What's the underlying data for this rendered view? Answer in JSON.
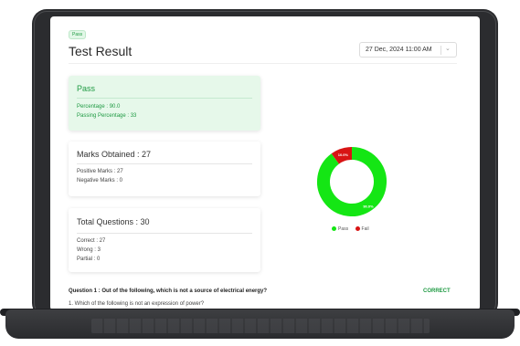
{
  "status_chip": "Pass",
  "title": "Test Result",
  "date_select": {
    "value": "27 Dec, 2024 11:00 AM"
  },
  "pass_card": {
    "heading": "Pass",
    "percentage": "Percentage : 90.0",
    "passing_percentage": "Passing Percentage : 33"
  },
  "marks_card": {
    "heading": "Marks Obtained : 27",
    "positive": "Positive Marks : 27",
    "negative": "Negative Marks : 0"
  },
  "total_card": {
    "heading": "Total Questions : 30",
    "correct": "Correct : 27",
    "wrong": "Wrong : 3",
    "partial": "Partial : 0"
  },
  "chart_data": {
    "type": "pie",
    "title": "",
    "categories": [
      "Pass",
      "Fail"
    ],
    "values": [
      90.0,
      10.0
    ],
    "labels": [
      "90.0%",
      "10.0%"
    ],
    "colors": [
      "#14e614",
      "#d81414"
    ],
    "donut": true,
    "legend": "bottom"
  },
  "question": {
    "title": "Question 1 : Out of the following, which is not a source of electrical energy?",
    "status": "CORRECT",
    "next_line": "1. Which of the following is not an expression of power?"
  }
}
